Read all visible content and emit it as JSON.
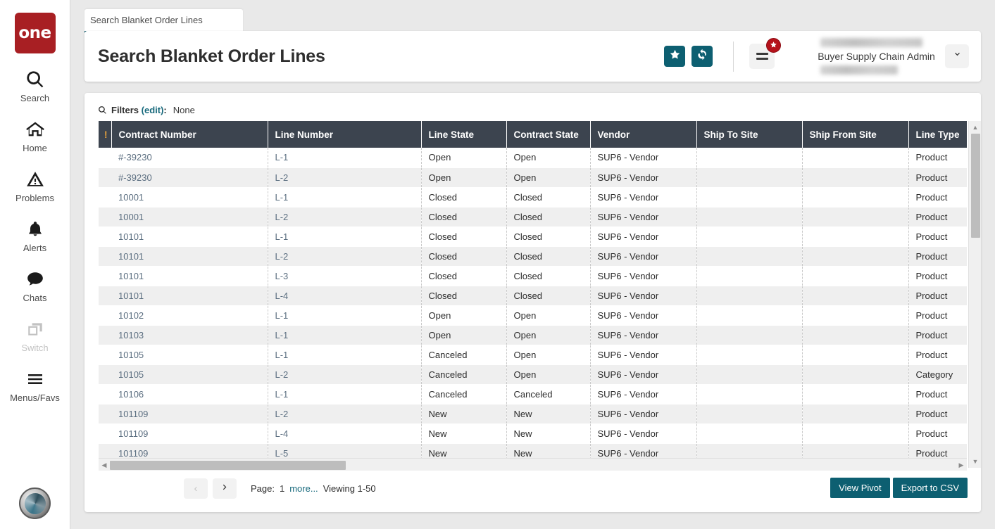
{
  "colors": {
    "teal": "#0d5f71",
    "header_bg": "#3c444f",
    "logo_red": "#a81f23",
    "badge_red": "#b5121b",
    "link": "#17697c",
    "cell_link": "#5b6e80",
    "bang_orange": "#e8a33d"
  },
  "sidebar": {
    "logo_text": "one",
    "items": [
      {
        "icon": "search-icon",
        "label": "Search",
        "disabled": false
      },
      {
        "icon": "home-icon",
        "label": "Home",
        "disabled": false
      },
      {
        "icon": "problems-icon",
        "label": "Problems",
        "disabled": false
      },
      {
        "icon": "alerts-bell-icon",
        "label": "Alerts",
        "disabled": false
      },
      {
        "icon": "chats-icon",
        "label": "Chats",
        "disabled": false
      },
      {
        "icon": "switch-icon",
        "label": "Switch",
        "disabled": true
      },
      {
        "icon": "menus-favs-icon",
        "label": "Menus/Favs",
        "disabled": false
      }
    ],
    "avatar_name": "user-avatar"
  },
  "tab": {
    "label": "Search Blanket Order Lines"
  },
  "header": {
    "title": "Search Blanket Order Lines",
    "favorite_button": "star-icon",
    "refresh_button": "refresh-icon",
    "menu_button": "hamburger-menu-icon",
    "menu_badge_icon": "star-badge-icon",
    "user_name": "Buyer Supply Chain Admin",
    "user_dropdown_icon": "chevron-down-icon"
  },
  "filters": {
    "icon": "search-icon",
    "label": "Filters",
    "edit_link": "(edit)",
    "colon": ":",
    "value": "None"
  },
  "table": {
    "columns": [
      {
        "key": "bang",
        "label": "!"
      },
      {
        "key": "contract_number",
        "label": "Contract Number"
      },
      {
        "key": "line_number",
        "label": "Line Number"
      },
      {
        "key": "line_state",
        "label": "Line State"
      },
      {
        "key": "contract_state",
        "label": "Contract State"
      },
      {
        "key": "vendor",
        "label": "Vendor"
      },
      {
        "key": "ship_to_site",
        "label": "Ship To Site"
      },
      {
        "key": "ship_from_site",
        "label": "Ship From Site"
      },
      {
        "key": "line_type",
        "label": "Line Type"
      }
    ],
    "rows": [
      {
        "bang": "",
        "contract_number": "#-39230",
        "line_number": "L-1",
        "line_state": "Open",
        "contract_state": "Open",
        "vendor": "SUP6 - Vendor",
        "ship_to_site": "",
        "ship_from_site": "",
        "line_type": "Product"
      },
      {
        "bang": "",
        "contract_number": "#-39230",
        "line_number": "L-2",
        "line_state": "Open",
        "contract_state": "Open",
        "vendor": "SUP6 - Vendor",
        "ship_to_site": "",
        "ship_from_site": "",
        "line_type": "Product"
      },
      {
        "bang": "",
        "contract_number": "10001",
        "line_number": "L-1",
        "line_state": "Closed",
        "contract_state": "Closed",
        "vendor": "SUP6 - Vendor",
        "ship_to_site": "",
        "ship_from_site": "",
        "line_type": "Product"
      },
      {
        "bang": "",
        "contract_number": "10001",
        "line_number": "L-2",
        "line_state": "Closed",
        "contract_state": "Closed",
        "vendor": "SUP6 - Vendor",
        "ship_to_site": "",
        "ship_from_site": "",
        "line_type": "Product"
      },
      {
        "bang": "",
        "contract_number": "10101",
        "line_number": "L-1",
        "line_state": "Closed",
        "contract_state": "Closed",
        "vendor": "SUP6 - Vendor",
        "ship_to_site": "",
        "ship_from_site": "",
        "line_type": "Product"
      },
      {
        "bang": "",
        "contract_number": "10101",
        "line_number": "L-2",
        "line_state": "Closed",
        "contract_state": "Closed",
        "vendor": "SUP6 - Vendor",
        "ship_to_site": "",
        "ship_from_site": "",
        "line_type": "Product"
      },
      {
        "bang": "",
        "contract_number": "10101",
        "line_number": "L-3",
        "line_state": "Closed",
        "contract_state": "Closed",
        "vendor": "SUP6 - Vendor",
        "ship_to_site": "",
        "ship_from_site": "",
        "line_type": "Product"
      },
      {
        "bang": "",
        "contract_number": "10101",
        "line_number": "L-4",
        "line_state": "Closed",
        "contract_state": "Closed",
        "vendor": "SUP6 - Vendor",
        "ship_to_site": "",
        "ship_from_site": "",
        "line_type": "Product"
      },
      {
        "bang": "",
        "contract_number": "10102",
        "line_number": "L-1",
        "line_state": "Open",
        "contract_state": "Open",
        "vendor": "SUP6 - Vendor",
        "ship_to_site": "",
        "ship_from_site": "",
        "line_type": "Product"
      },
      {
        "bang": "",
        "contract_number": "10103",
        "line_number": "L-1",
        "line_state": "Open",
        "contract_state": "Open",
        "vendor": "SUP6 - Vendor",
        "ship_to_site": "",
        "ship_from_site": "",
        "line_type": "Product"
      },
      {
        "bang": "",
        "contract_number": "10105",
        "line_number": "L-1",
        "line_state": "Canceled",
        "contract_state": "Open",
        "vendor": "SUP6 - Vendor",
        "ship_to_site": "",
        "ship_from_site": "",
        "line_type": "Product"
      },
      {
        "bang": "",
        "contract_number": "10105",
        "line_number": "L-2",
        "line_state": "Canceled",
        "contract_state": "Open",
        "vendor": "SUP6 - Vendor",
        "ship_to_site": "",
        "ship_from_site": "",
        "line_type": "Category"
      },
      {
        "bang": "",
        "contract_number": "10106",
        "line_number": "L-1",
        "line_state": "Canceled",
        "contract_state": "Canceled",
        "vendor": "SUP6 - Vendor",
        "ship_to_site": "",
        "ship_from_site": "",
        "line_type": "Product"
      },
      {
        "bang": "",
        "contract_number": "101109",
        "line_number": "L-2",
        "line_state": "New",
        "contract_state": "New",
        "vendor": "SUP6 - Vendor",
        "ship_to_site": "",
        "ship_from_site": "",
        "line_type": "Product"
      },
      {
        "bang": "",
        "contract_number": "101109",
        "line_number": "L-4",
        "line_state": "New",
        "contract_state": "New",
        "vendor": "SUP6 - Vendor",
        "ship_to_site": "",
        "ship_from_site": "",
        "line_type": "Product"
      },
      {
        "bang": "",
        "contract_number": "101109",
        "line_number": "L-5",
        "line_state": "New",
        "contract_state": "New",
        "vendor": "SUP6 - Vendor",
        "ship_to_site": "",
        "ship_from_site": "",
        "line_type": "Product"
      }
    ]
  },
  "footer": {
    "prev_label": "‹",
    "next_label": "›",
    "page_label": "Page:",
    "page_number": "1",
    "more_label": "more...",
    "viewing_label": "Viewing 1-50",
    "view_pivot_label": "View Pivot",
    "export_csv_label": "Export to CSV"
  }
}
